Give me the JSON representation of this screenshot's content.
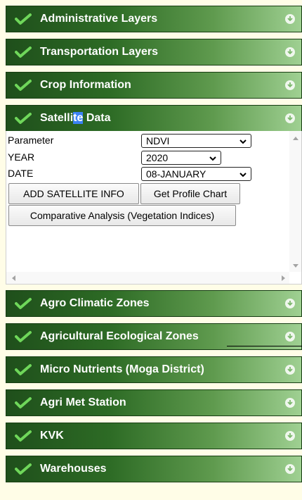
{
  "panels": [
    {
      "id": "administrative",
      "label": "Administrative Layers"
    },
    {
      "id": "transportation",
      "label": "Transportation Layers"
    },
    {
      "id": "crop",
      "label": "Crop Information"
    },
    {
      "id": "satellite",
      "label_parts": [
        "Satelli",
        "te",
        " Data"
      ]
    },
    {
      "id": "agro-climatic",
      "label": "Agro Climatic Zones"
    },
    {
      "id": "ecological",
      "label": "Agricultural Ecological Zones"
    },
    {
      "id": "micro-nutrients",
      "label": "Micro Nutrients (Moga District)"
    },
    {
      "id": "agri-met",
      "label": "Agri Met Station"
    },
    {
      "id": "kvk",
      "label": "KVK"
    },
    {
      "id": "warehouses",
      "label": "Warehouses"
    }
  ],
  "satellite_form": {
    "parameter_label": "Parameter",
    "parameter_value": "NDVI",
    "year_label": "YEAR",
    "year_value": "2020",
    "date_label": "DATE",
    "date_value": "08-JANUARY",
    "add_button": "ADD SATELLITE INFO",
    "profile_button": "Get Profile Chart",
    "compare_button": "Comparative Analysis (Vegetation Indices)"
  },
  "icons": {
    "check": "checkmark-icon",
    "expand": "expand-circle-icon"
  },
  "colors": {
    "header_dark": "#1f4f1b",
    "header_light": "#9fd092",
    "check_green": "#6fd75a",
    "page_background": "#fffde7"
  }
}
